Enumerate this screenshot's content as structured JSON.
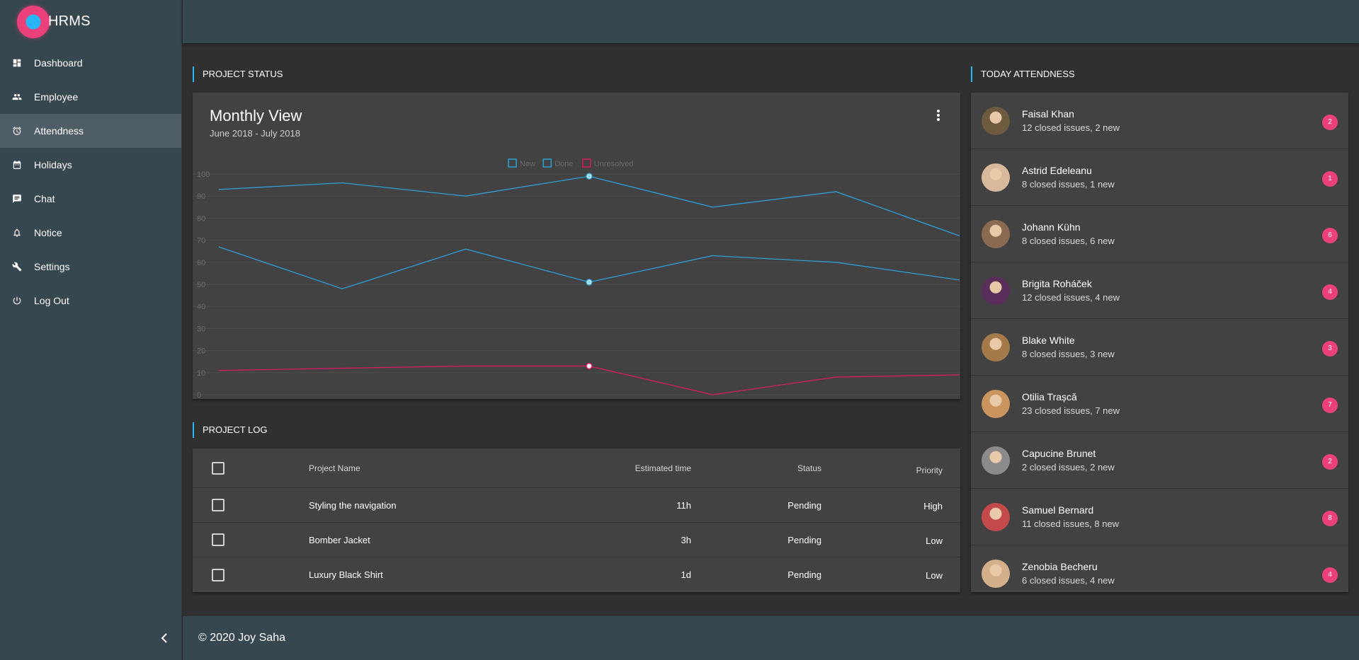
{
  "brand": {
    "name": "HRMS"
  },
  "nav": [
    {
      "label": "Dashboard",
      "icon": "dashboard-icon",
      "active": false
    },
    {
      "label": "Employee",
      "icon": "people-icon",
      "active": false
    },
    {
      "label": "Attendness",
      "icon": "alarm-icon",
      "active": true
    },
    {
      "label": "Holidays",
      "icon": "calendar-icon",
      "active": false
    },
    {
      "label": "Chat",
      "icon": "chat-icon",
      "active": false
    },
    {
      "label": "Notice",
      "icon": "bell-icon",
      "active": false
    },
    {
      "label": "Settings",
      "icon": "wrench-icon",
      "active": false
    },
    {
      "label": "Log Out",
      "icon": "power-icon",
      "active": false
    }
  ],
  "sections": {
    "project_status": "PROJECT STATUS",
    "project_log": "PROJECT LOG",
    "today_attendance": "TODAY ATTENDNESS"
  },
  "chart_data": {
    "type": "line",
    "title": "Monthly View",
    "subtitle": "June 2018 - July 2018",
    "ylim": [
      0,
      100
    ],
    "yticks": [
      0,
      10,
      20,
      30,
      40,
      50,
      60,
      70,
      80,
      90,
      100
    ],
    "grid": true,
    "legend_position": "top-center",
    "series": [
      {
        "name": "New",
        "color": "#2e9fd4",
        "values": [
          93,
          96,
          90,
          99,
          85,
          92,
          72
        ]
      },
      {
        "name": "Done",
        "color": "#2e9fd4",
        "values": [
          67,
          48,
          66,
          51,
          63,
          60,
          52
        ]
      },
      {
        "name": "Unresolved",
        "color": "#d81b60",
        "values": [
          11,
          12,
          13,
          13,
          0,
          8,
          9
        ]
      }
    ],
    "highlight_index": 3
  },
  "table": {
    "headers": {
      "name": "Project Name",
      "time": "Estimated time",
      "status": "Status",
      "priority": "Priority"
    },
    "rows": [
      {
        "name": "Styling the navigation",
        "time": "11h",
        "status": "Pending",
        "priority": "High"
      },
      {
        "name": "Bomber Jacket",
        "time": "3h",
        "status": "Pending",
        "priority": "Low"
      },
      {
        "name": "Luxury Black Shirt",
        "time": "1d",
        "status": "Pending",
        "priority": "Low"
      }
    ]
  },
  "attendance": [
    {
      "name": "Faisal Khan",
      "summary": "12 closed issues, 2 new",
      "badge": "2",
      "avatar_color": "#6d5a3f"
    },
    {
      "name": "Astrid Edeleanu",
      "summary": "8 closed issues, 1 new",
      "badge": "1",
      "avatar_color": "#d9b99b"
    },
    {
      "name": "Johann Kühn",
      "summary": "8 closed issues, 6 new",
      "badge": "6",
      "avatar_color": "#8a6a50"
    },
    {
      "name": "Brigita Roháček",
      "summary": "12 closed issues, 4 new",
      "badge": "4",
      "avatar_color": "#5b2d5a"
    },
    {
      "name": "Blake White",
      "summary": "8 closed issues, 3 new",
      "badge": "3",
      "avatar_color": "#a57a4a"
    },
    {
      "name": "Otilia Trașcă",
      "summary": "23 closed issues, 7 new",
      "badge": "7",
      "avatar_color": "#c9945e"
    },
    {
      "name": "Capucine Brunet",
      "summary": "2 closed issues, 2 new",
      "badge": "2",
      "avatar_color": "#8b8b8b"
    },
    {
      "name": "Samuel Bernard",
      "summary": "11 closed issues, 8 new",
      "badge": "8",
      "avatar_color": "#c44a4a"
    },
    {
      "name": "Zenobia Becheru",
      "summary": "6 closed issues, 4 new",
      "badge": "4",
      "avatar_color": "#d4b08a"
    }
  ],
  "footer": {
    "text": "© 2020 Joy Saha"
  },
  "colors": {
    "accent": "#29b6f6",
    "badge": "#ec407a",
    "sidebar": "#37474f",
    "card": "#424242"
  }
}
